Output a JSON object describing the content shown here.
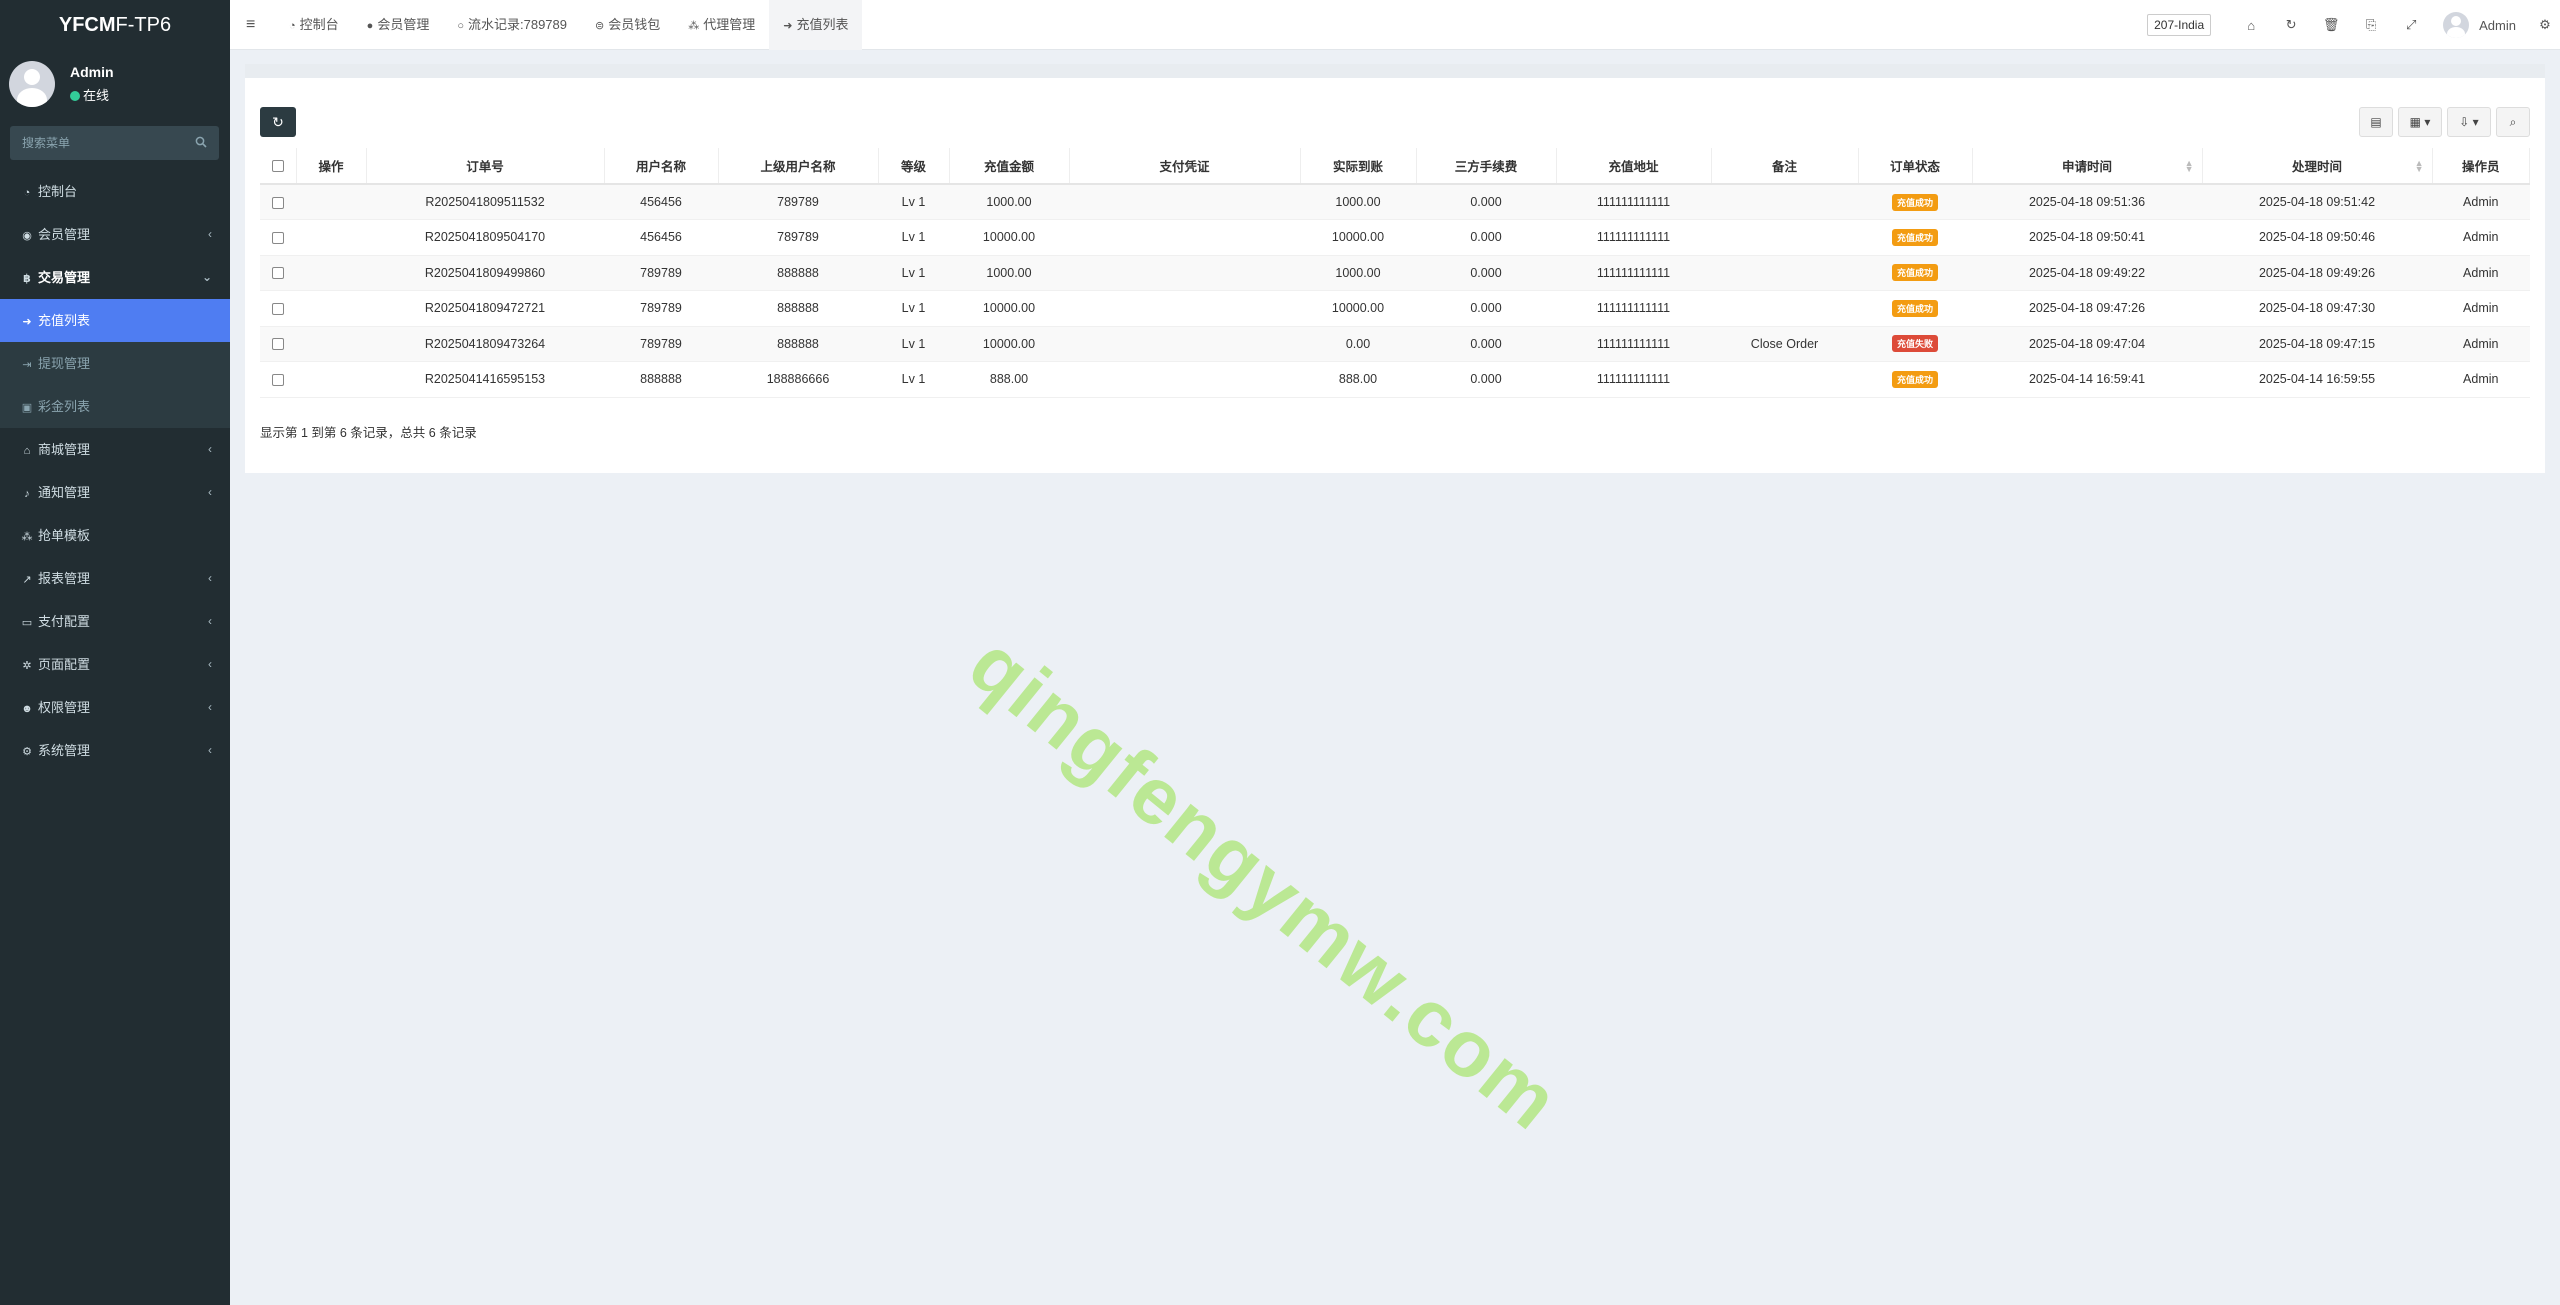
{
  "app": {
    "logo_bold": "YFCM",
    "logo_rest": "F-TP6"
  },
  "user": {
    "name": "Admin",
    "status": "在线"
  },
  "search": {
    "placeholder": "搜索菜单"
  },
  "sidebar": {
    "items": [
      {
        "icon": "dashboard-icon",
        "label": "控制台"
      },
      {
        "icon": "user-circle-icon",
        "label": "会员管理"
      },
      {
        "icon": "bitcoin-icon",
        "label": "交易管理"
      },
      {
        "icon": "sign-in-icon",
        "label": "充值列表"
      },
      {
        "icon": "sign-out-icon",
        "label": "提现管理"
      },
      {
        "icon": "briefcase-icon",
        "label": "彩金列表"
      },
      {
        "icon": "home-icon",
        "label": "商城管理"
      },
      {
        "icon": "bell-icon",
        "label": "通知管理"
      },
      {
        "icon": "sitemap-icon",
        "label": "抢单模板"
      },
      {
        "icon": "line-chart-icon",
        "label": "报表管理"
      },
      {
        "icon": "credit-card-icon",
        "label": "支付配置"
      },
      {
        "icon": "gear-icon",
        "label": "页面配置"
      },
      {
        "icon": "users-icon",
        "label": "权限管理"
      },
      {
        "icon": "gears-icon",
        "label": "系统管理"
      }
    ]
  },
  "tabs": [
    {
      "icon": "dashboard-icon",
      "label": "控制台"
    },
    {
      "icon": "user-icon",
      "label": "会员管理"
    },
    {
      "icon": "circle-icon",
      "label": "流水记录:789789"
    },
    {
      "icon": "wallet-icon",
      "label": "会员钱包"
    },
    {
      "icon": "sitemap-icon",
      "label": "代理管理"
    },
    {
      "icon": "sign-in-icon",
      "label": "充值列表"
    }
  ],
  "topbar": {
    "lang": "207-India",
    "user": "Admin"
  },
  "table": {
    "headers": [
      "操作",
      "订单号",
      "用户名称",
      "上级用户名称",
      "等级",
      "充值金额",
      "支付凭证",
      "实际到账",
      "三方手续费",
      "充值地址",
      "备注",
      "订单状态",
      "申请时间",
      "处理时间",
      "操作员"
    ],
    "rows": [
      {
        "order": "R2025041809511532",
        "user": "456456",
        "parent": "789789",
        "level": "Lv 1",
        "amount": "1000.00",
        "proof": "",
        "actual": "1000.00",
        "fee": "0.000",
        "address": "111111111111",
        "note": "",
        "status": "充值成功",
        "status_type": "success",
        "applied": "2025-04-18 09:51:36",
        "processed": "2025-04-18 09:51:42",
        "operator": "Admin"
      },
      {
        "order": "R2025041809504170",
        "user": "456456",
        "parent": "789789",
        "level": "Lv 1",
        "amount": "10000.00",
        "proof": "",
        "actual": "10000.00",
        "fee": "0.000",
        "address": "111111111111",
        "note": "",
        "status": "充值成功",
        "status_type": "success",
        "applied": "2025-04-18 09:50:41",
        "processed": "2025-04-18 09:50:46",
        "operator": "Admin"
      },
      {
        "order": "R2025041809499860",
        "user": "789789",
        "parent": "888888",
        "level": "Lv 1",
        "amount": "1000.00",
        "proof": "",
        "actual": "1000.00",
        "fee": "0.000",
        "address": "111111111111",
        "note": "",
        "status": "充值成功",
        "status_type": "success",
        "applied": "2025-04-18 09:49:22",
        "processed": "2025-04-18 09:49:26",
        "operator": "Admin"
      },
      {
        "order": "R2025041809472721",
        "user": "789789",
        "parent": "888888",
        "level": "Lv 1",
        "amount": "10000.00",
        "proof": "",
        "actual": "10000.00",
        "fee": "0.000",
        "address": "111111111111",
        "note": "",
        "status": "充值成功",
        "status_type": "success",
        "applied": "2025-04-18 09:47:26",
        "processed": "2025-04-18 09:47:30",
        "operator": "Admin"
      },
      {
        "order": "R2025041809473264",
        "user": "789789",
        "parent": "888888",
        "level": "Lv 1",
        "amount": "10000.00",
        "proof": "",
        "actual": "0.00",
        "fee": "0.000",
        "address": "111111111111",
        "note": "Close Order",
        "status": "充值失败",
        "status_type": "fail",
        "applied": "2025-04-18 09:47:04",
        "processed": "2025-04-18 09:47:15",
        "operator": "Admin"
      },
      {
        "order": "R2025041416595153",
        "user": "888888",
        "parent": "188886666",
        "level": "Lv 1",
        "amount": "888.00",
        "proof": "",
        "actual": "888.00",
        "fee": "0.000",
        "address": "111111111111",
        "note": "",
        "status": "充值成功",
        "status_type": "success",
        "applied": "2025-04-14 16:59:41",
        "processed": "2025-04-14 16:59:55",
        "operator": "Admin"
      }
    ]
  },
  "pager": {
    "info": "显示第 1 到第 6 条记录，总共 6 条记录"
  },
  "watermark": "qingfengymw.com",
  "colors": {
    "sidebar_bg": "#222d32",
    "accent": "#4f7df2",
    "success_badge": "#f39c12",
    "fail_badge": "#dd4b39",
    "watermark": "#b6e88a"
  }
}
